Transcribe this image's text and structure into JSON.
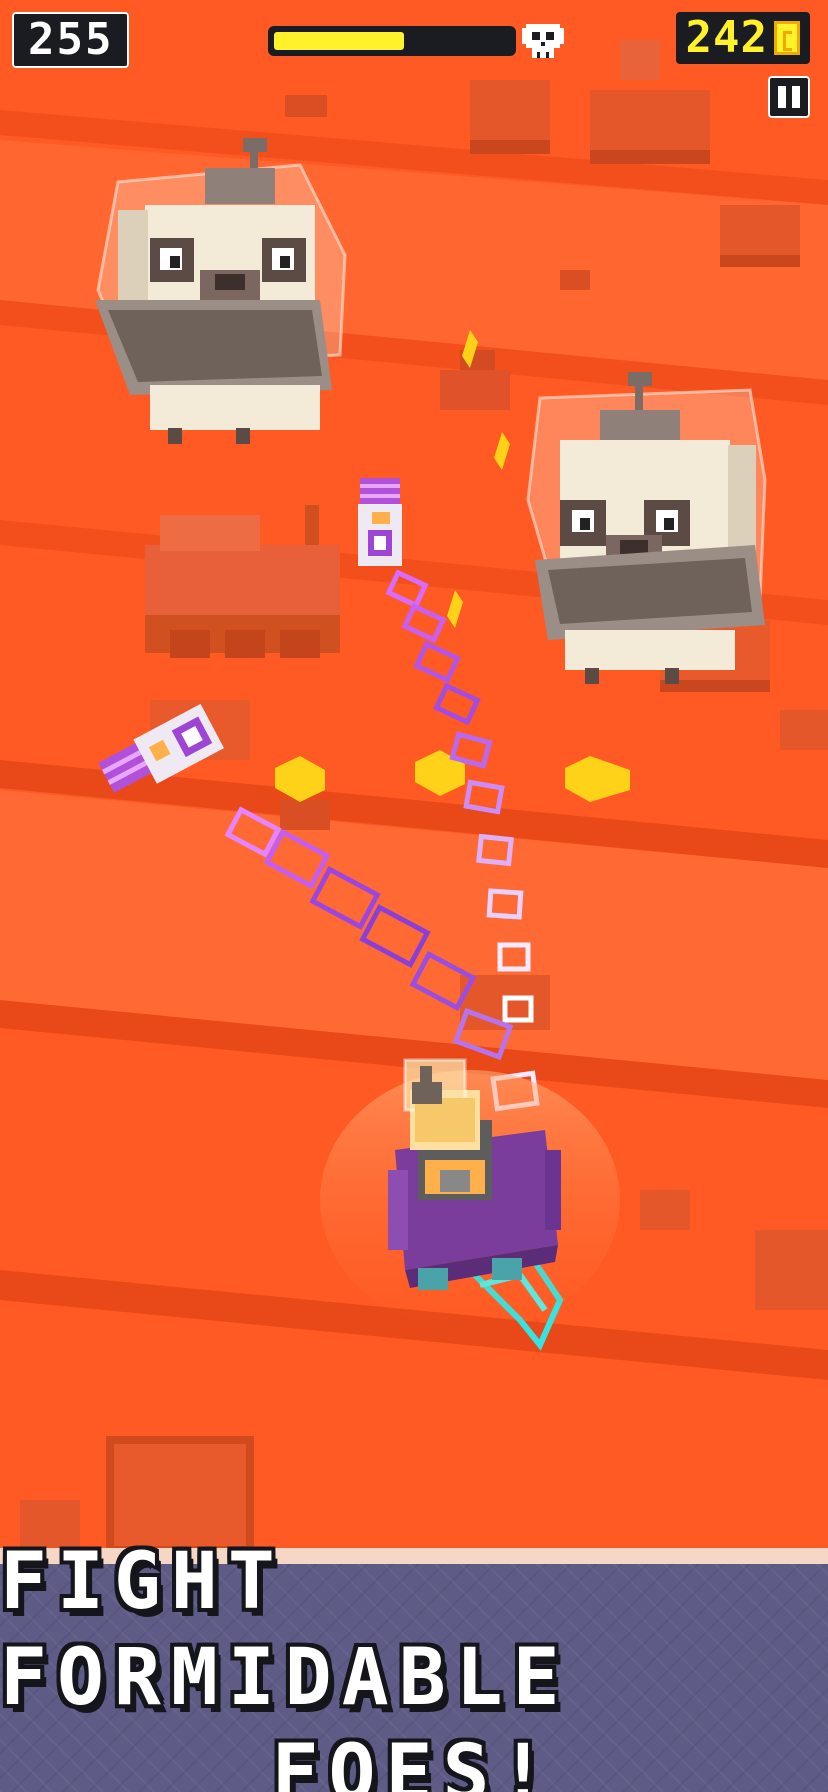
{
  "hud": {
    "score": "255",
    "coins": "242",
    "boss_health": 0.55,
    "icons": {
      "boss": "skull-icon",
      "coin": "coin-icon",
      "pause": "pause-icon"
    }
  },
  "banner": {
    "line1": "FIGHT FORMIDABLE",
    "line2": "FOES!"
  },
  "colors": {
    "background": "#ff5a24",
    "hud_dark": "#1b1b22",
    "health_fill": "#fff12a",
    "coin": "#fff12a",
    "banner": "#5e5b86"
  }
}
